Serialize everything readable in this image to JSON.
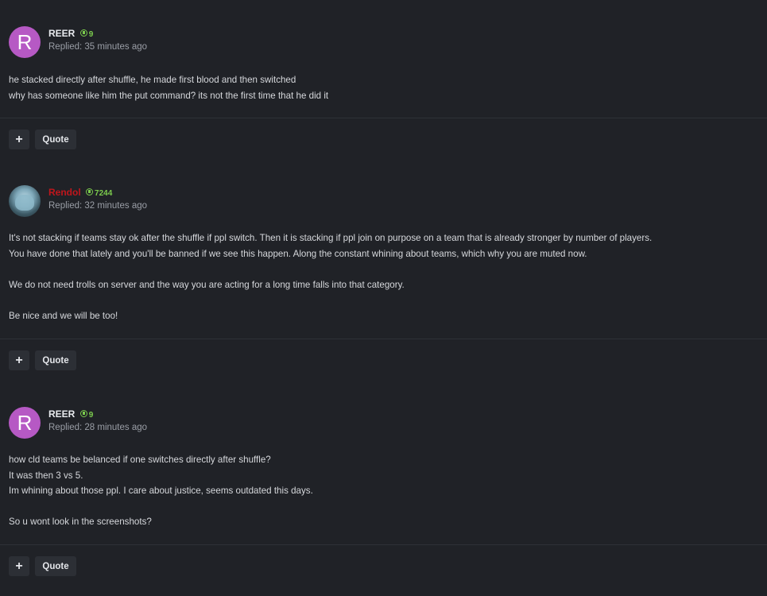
{
  "posts": [
    {
      "avatar_letter": "R",
      "avatar_color": "#b659c4",
      "username": "REER",
      "reputation": "9",
      "replied": "Replied: 35 minutes ago",
      "paragraphs": [
        "he stacked directly after shuffle, he made first blood and then switched",
        "why has someone like him the put command? its not the first time that he did it"
      ],
      "plus_label": "+",
      "quote_label": "Quote"
    },
    {
      "avatar_letter": "",
      "username": "Rendol",
      "username_color": "#c0161c",
      "reputation": "7244",
      "replied": "Replied: 32 minutes ago",
      "paragraphs": [
        "It's not stacking if teams stay ok after the shuffle if ppl switch. Then it is stacking if ppl join on purpose on a team that is already stronger by number of players.",
        "You have done that lately and you'll be banned if we see this happen. Along the constant whining about teams, which why you are muted now.",
        "",
        "We do not need trolls on server and the way you are acting for a long time falls into that category.",
        "",
        "Be nice and we will be too!"
      ],
      "plus_label": "+",
      "quote_label": "Quote"
    },
    {
      "avatar_letter": "R",
      "avatar_color": "#b659c4",
      "username": "REER",
      "reputation": "9",
      "replied": "Replied: 28 minutes ago",
      "paragraphs": [
        "how cld teams be belanced if one switches directly after shuffle?",
        "It was then 3 vs 5.",
        "Im whining about those ppl. I care about justice, seems outdated this days.",
        "",
        "So u wont look in the screenshots?"
      ],
      "plus_label": "+",
      "quote_label": "Quote"
    }
  ],
  "colors": {
    "background": "#202227",
    "reputation": "#7bcb4d",
    "staff_name": "#c0161c",
    "button_bg": "#2c2f35"
  }
}
